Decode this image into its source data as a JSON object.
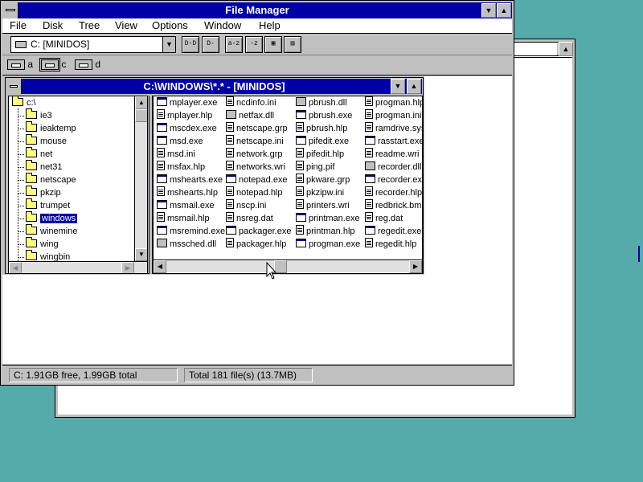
{
  "app": {
    "title": "File Manager"
  },
  "menu": [
    "File",
    "Disk",
    "Tree",
    "View",
    "Options",
    "Window",
    "Help"
  ],
  "toolbar": {
    "drive_select": "C: [MINIDOS]",
    "buttons": [
      "drive-connect",
      "drive-disconnect",
      "view-by-name",
      "view-by-type",
      "sort-by-name",
      "sort-by-type",
      "copy-disk"
    ]
  },
  "drives": [
    {
      "letter": "a",
      "icon": "floppy-drive-icon"
    },
    {
      "letter": "c",
      "icon": "hard-drive-icon"
    },
    {
      "letter": "d",
      "icon": "cdrom-drive-icon"
    }
  ],
  "child_window": {
    "title": "C:\\WINDOWS\\*.* - [MINIDOS]"
  },
  "tree": {
    "root": "c:\\",
    "items": [
      "ie3",
      "ieaktemp",
      "mouse",
      "net",
      "net31",
      "netscape",
      "pkzip",
      "trumpet",
      "windows",
      "winemine",
      "wing",
      "wingbin"
    ],
    "selected": "windows"
  },
  "files": {
    "columns": [
      [
        "mplayer.exe",
        "mplayer.hlp",
        "mscdex.exe",
        "msd.exe",
        "msd.ini",
        "msfax.hlp",
        "mshearts.exe",
        "mshearts.hlp",
        "msmail.exe",
        "msmail.hlp",
        "msremind.exe",
        "mssched.dll"
      ],
      [
        "ncdinfo.ini",
        "netfax.dll",
        "netscape.grp",
        "netscape.ini",
        "network.grp",
        "networks.wri",
        "notepad.exe",
        "notepad.hlp",
        "nscp.ini",
        "nsreg.dat",
        "packager.exe",
        "packager.hlp"
      ],
      [
        "pbrush.dll",
        "pbrush.exe",
        "pbrush.hlp",
        "pifedit.exe",
        "pifedit.hlp",
        "ping.pif",
        "pkware.grp",
        "pkzipw.ini",
        "printers.wri",
        "printman.exe",
        "printman.hlp",
        "progman.exe"
      ],
      [
        "progman.hlp",
        "progman.ini",
        "ramdrive.sys",
        "rasstart.exe",
        "readme.wri",
        "recorder.dll",
        "recorder.exe",
        "recorder.hlp",
        "redbrick.bmp",
        "reg.dat",
        "regedit.exe",
        "regedit.hlp"
      ]
    ]
  },
  "status": {
    "free": "C: 1.91GB free,  1.99GB total",
    "total": "Total 181 file(s) (13.7MB)"
  },
  "colors": {
    "desktop": "#55aaaa",
    "titlebar": "#0000a8",
    "face": "#c0c0c0"
  }
}
